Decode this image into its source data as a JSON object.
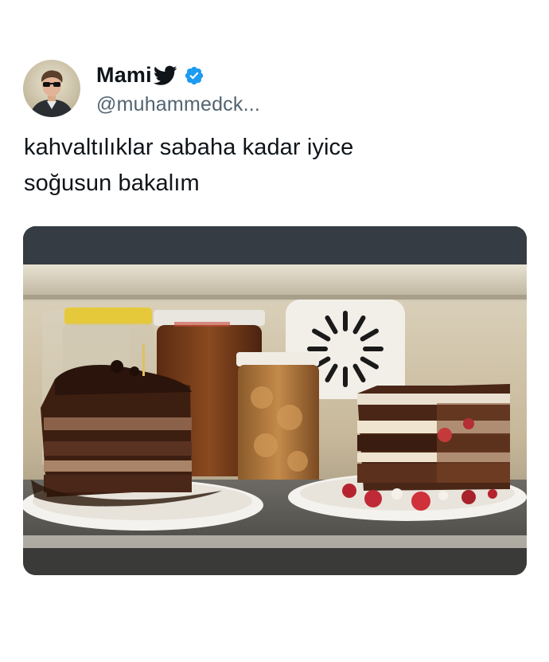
{
  "author": {
    "display_name": "Mami",
    "handle": "@muhammedck...",
    "verified": true,
    "avatar_icon": "user-avatar",
    "badge_icon": "twitter-bird-icon",
    "verified_icon": "verified-badge-icon"
  },
  "tweet": {
    "text_lines": [
      "kahvaltılıklar sabaha kadar iyice",
      "soğusun bakalım"
    ]
  },
  "media": {
    "kind": "photo"
  },
  "colors": {
    "text_primary": "#0f1419",
    "text_secondary": "#536471",
    "verified_blue": "#1d9bf0",
    "background": "#ffffff"
  }
}
